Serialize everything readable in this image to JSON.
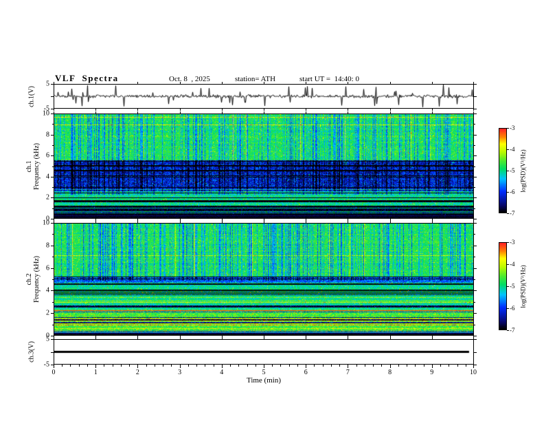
{
  "chart_data": {
    "type": "multi-panel",
    "title": "VLF  Spectra",
    "annotations": {
      "date": "Oct. 8  , 2025",
      "station": "station= ATH",
      "start_ut": "start UT =  14:40: 0"
    },
    "x_axis": {
      "label": "Time  (min)",
      "range": [
        0,
        10
      ],
      "major_ticks": [
        0,
        1,
        2,
        3,
        4,
        5,
        6,
        7,
        8,
        9,
        10
      ],
      "minor_per_major": 5
    },
    "colorbar": {
      "label": "log(PSD)(V²/Hz)",
      "range": [
        -7,
        -3
      ],
      "tick_values": [
        -3,
        -4,
        -5,
        -6,
        -7
      ],
      "colormap_stops": [
        [
          0.0,
          [
            0,
            0,
            0
          ]
        ],
        [
          0.08,
          [
            8,
            8,
            105
          ]
        ],
        [
          0.25,
          [
            0,
            45,
            255
          ]
        ],
        [
          0.4,
          [
            0,
            195,
            255
          ]
        ],
        [
          0.52,
          [
            0,
            222,
            100
          ]
        ],
        [
          0.62,
          [
            80,
            235,
            45
          ]
        ],
        [
          0.72,
          [
            185,
            250,
            0
          ]
        ],
        [
          0.82,
          [
            255,
            255,
            0
          ]
        ],
        [
          0.9,
          [
            255,
            135,
            0
          ]
        ],
        [
          1.0,
          [
            255,
            35,
            35
          ]
        ]
      ]
    },
    "panels": [
      {
        "id": "ch1_waveform",
        "type": "line",
        "channel_label": "ch.1(V)",
        "ylim": [
          -5,
          5
        ],
        "ytick_values": [
          5,
          0,
          -5
        ],
        "ytick_labeled": [
          5,
          -5
        ],
        "description": "broadband noise around 0 V with frequent impulsive spikes",
        "waveform": {
          "seed": 1977,
          "noise": 0.8,
          "spike_prob": 0.07,
          "spike_min": 1.6,
          "spike_max": 4.6,
          "x_end_frac": 1.0
        }
      },
      {
        "id": "ch1_spectrogram",
        "type": "heatmap",
        "channel_label": "ch.1",
        "ylabel": "Frequency  (kHz)",
        "ylim": [
          0,
          10
        ],
        "ytick_values": [
          0,
          2,
          4,
          6,
          8,
          10
        ],
        "zlim": [
          -7,
          -3
        ],
        "description": "green background above ~5.6 kHz with dense dark-blue vertical sferic streaks; deep blue band 2.6-5.6 kHz; green/cyan speckle 1.2-2.6 kHz; striped green/black band below 1.2 kHz; black band near 0 kHz",
        "spectrogram": {
          "seed": 41,
          "f_top": 10,
          "streaks": {
            "prob": 0.32,
            "depth": 1.0,
            "f_min": 2.3
          },
          "bright_columns": {
            "prob": 0.025,
            "amp": 0.7,
            "f_min": 5.2
          },
          "bands": [
            {
              "f": [
                0,
                0.35
              ],
              "base": -6.9,
              "speckle": 0.1,
              "dark_row": 0.0,
              "bright_row": 0.15,
              "hot_row": 0,
              "glint": 0,
              "hot": 0
            },
            {
              "f": [
                0.35,
                1.2
              ],
              "base": -5.35,
              "speckle": 0.5,
              "dark_row": 0.4,
              "bright_row": 0.15,
              "hot_row": 0,
              "glint": 0.01,
              "hot": 0
            },
            {
              "f": [
                1.2,
                2.6
              ],
              "base": -5.05,
              "speckle": 0.45,
              "dark_row": 0.15,
              "bright_row": 0.05,
              "hot_row": 0.01,
              "glint": 0.02,
              "hot": 0.0005
            },
            {
              "f": [
                2.6,
                5.6
              ],
              "base": -6.2,
              "speckle": 0.55,
              "dark_row": 0.12,
              "bright_row": 0.03,
              "hot_row": 0,
              "glint": 0.05,
              "hot": 0.0003
            },
            {
              "f": [
                5.6,
                10
              ],
              "base": -4.8,
              "speckle": 0.38,
              "dark_row": 0.03,
              "bright_row": 0.04,
              "hot_row": 0,
              "glint": 0.025,
              "hot": 0.002
            }
          ]
        }
      },
      {
        "id": "ch2_spectrogram",
        "type": "heatmap",
        "channel_label": "ch.2",
        "ylabel": "Frequency  (kHz)",
        "ylim": [
          0,
          10
        ],
        "ytick_values": [
          0,
          2,
          4,
          6,
          8,
          10
        ],
        "zlim": [
          -7,
          -3
        ],
        "description": "green background above ~5.3 kHz with blue vertical streaks; blue band 4.7-5.3 kHz; green with many dark horizontal lines 2.3-4.7 kHz; bright green/yellow band with black and red horizontal lines 0.3-2.3 kHz; black band near 0 kHz",
        "spectrogram": {
          "seed": 97,
          "f_top": 10,
          "streaks": {
            "prob": 0.3,
            "depth": 1.05,
            "f_min": 4.9
          },
          "bright_columns": {
            "prob": 0.02,
            "amp": 0.7,
            "f_min": 5.3
          },
          "bands": [
            {
              "f": [
                0,
                0.3
              ],
              "base": -6.9,
              "speckle": 0.1,
              "dark_row": 0,
              "bright_row": 0.12,
              "hot_row": 0,
              "glint": 0,
              "hot": 0
            },
            {
              "f": [
                0.3,
                2.3
              ],
              "base": -4.6,
              "speckle": 0.45,
              "dark_row": 0.3,
              "bright_row": 0.12,
              "hot_row": 0.05,
              "glint": 0.01,
              "hot": 0.0008
            },
            {
              "f": [
                2.3,
                4.7
              ],
              "base": -5.05,
              "speckle": 0.4,
              "dark_row": 0.22,
              "bright_row": 0.06,
              "hot_row": 0.01,
              "glint": 0.02,
              "hot": 0.0004
            },
            {
              "f": [
                4.7,
                5.3
              ],
              "base": -5.8,
              "speckle": 0.5,
              "dark_row": 0.12,
              "bright_row": 0.02,
              "hot_row": 0,
              "glint": 0.04,
              "hot": 0
            },
            {
              "f": [
                5.3,
                10
              ],
              "base": -4.8,
              "speckle": 0.36,
              "dark_row": 0.04,
              "bright_row": 0.04,
              "hot_row": 0,
              "glint": 0.02,
              "hot": 0.0015
            }
          ]
        }
      },
      {
        "id": "ch3_waveform",
        "type": "line",
        "channel_label": "ch.3(V)",
        "ylim": [
          -5,
          5
        ],
        "ytick_values": [
          5,
          0,
          -5
        ],
        "ytick_labeled": [
          5,
          -5
        ],
        "description": "flat signal at 0 V (thick solid line)",
        "waveform": {
          "flat": true,
          "value": 0,
          "thickness": 3,
          "x_end_frac": 0.99
        }
      }
    ]
  }
}
